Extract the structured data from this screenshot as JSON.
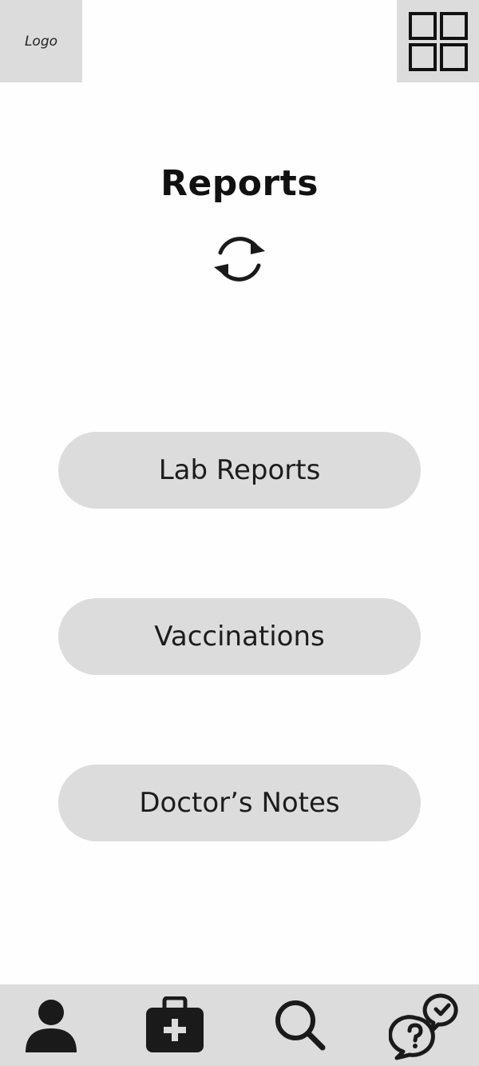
{
  "header": {
    "logo_text": "Logo",
    "menu_icon": "grid-icon"
  },
  "main": {
    "title": "Reports",
    "refresh_icon": "refresh-icon",
    "buttons": [
      {
        "label": "Lab Reports"
      },
      {
        "label": "Vaccinations"
      },
      {
        "label": "Doctor’s Notes"
      }
    ]
  },
  "bottom_nav": {
    "items": [
      {
        "icon": "user-icon"
      },
      {
        "icon": "medical-kit-icon"
      },
      {
        "icon": "search-icon"
      },
      {
        "icon": "help-chat-icon"
      }
    ]
  },
  "colors": {
    "background": "#fefefe",
    "panel": "#dcdcdc",
    "ink": "#1a1a1a"
  }
}
